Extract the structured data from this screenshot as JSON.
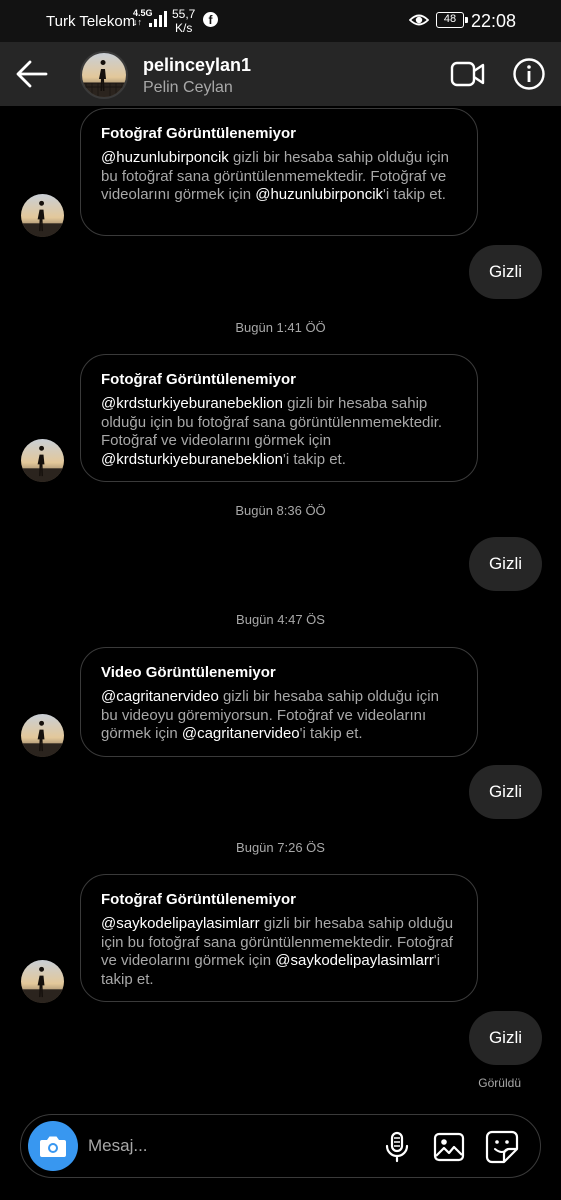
{
  "status_bar": {
    "carrier": "Turk Telekom",
    "network_top": "4.5G",
    "network_bottom": "↓↑",
    "speed_value": "55,7",
    "speed_unit": "K/s",
    "battery": "48",
    "time": "22:08",
    "icons": [
      "signal-icon",
      "facebook-icon",
      "eye-comfort-icon",
      "battery-icon"
    ]
  },
  "header": {
    "username": "pelinceylan1",
    "full_name": "Pelin Ceylan",
    "icons": [
      "back-arrow-icon",
      "video-call-icon",
      "info-icon"
    ]
  },
  "messages": [
    {
      "title": "Fotoğraf Görüntülenemiyor",
      "parts": [
        {
          "text": "@huzunlubirponcik",
          "mention": true
        },
        {
          "text": " gizli bir hesaba sahip olduğu için bu fotoğraf sana görüntülenmemektedir. Fotoğraf ve videolarını görmek için ",
          "mention": false
        },
        {
          "text": "@huzunlubirponcik",
          "mention": true
        },
        {
          "text": "'i takip et.",
          "mention": false
        }
      ]
    },
    {
      "title": "Fotoğraf Görüntülenemiyor",
      "parts": [
        {
          "text": "@krdsturkiyeburanebeklion",
          "mention": true
        },
        {
          "text": " gizli bir hesaba sahip olduğu için bu fotoğraf sana görüntülenmemektedir. Fotoğraf ve videolarını görmek için ",
          "mention": false
        },
        {
          "text": "@krdsturkiyeburanebeklion",
          "mention": true
        },
        {
          "text": "'i takip et.",
          "mention": false
        }
      ]
    },
    {
      "title": "Video Görüntülenemiyor",
      "parts": [
        {
          "text": "@cagritanervideo",
          "mention": true
        },
        {
          "text": " gizli bir hesaba sahip olduğu için bu videoyu göremiyorsun. Fotoğraf ve videolarını görmek için ",
          "mention": false
        },
        {
          "text": "@cagritanervideo",
          "mention": true
        },
        {
          "text": "'i takip et.",
          "mention": false
        }
      ]
    },
    {
      "title": "Fotoğraf Görüntülenemiyor",
      "parts": [
        {
          "text": "@saykodelipaylasimlarr",
          "mention": true
        },
        {
          "text": " gizli bir hesaba sahip olduğu için bu fotoğraf sana görüntülenmemektedir. Fotoğraf ve videolarını görmek için ",
          "mention": false
        },
        {
          "text": "@saykodelipaylasimlarr",
          "mention": true
        },
        {
          "text": "'i takip et.",
          "mention": false
        }
      ]
    }
  ],
  "replies": [
    "Gizli",
    "Gizli",
    "Gizli",
    "Gizli"
  ],
  "timestamps": [
    "Bugün 1:41 ÖÖ",
    "Bugün 8:36 ÖÖ",
    "Bugün 4:47 ÖS",
    "Bugün 7:26 ÖS"
  ],
  "seen_label": "Görüldü",
  "composer": {
    "placeholder": "Mesaj...",
    "icons": [
      "camera-icon",
      "microphone-icon",
      "gallery-icon",
      "sticker-icon"
    ]
  },
  "colors": {
    "background": "#000000",
    "header": "#262626",
    "bubble": "#262626",
    "card_border": "#3a3a3a",
    "muted_text": "#a8a8a8",
    "camera_button": "#3897f0"
  }
}
